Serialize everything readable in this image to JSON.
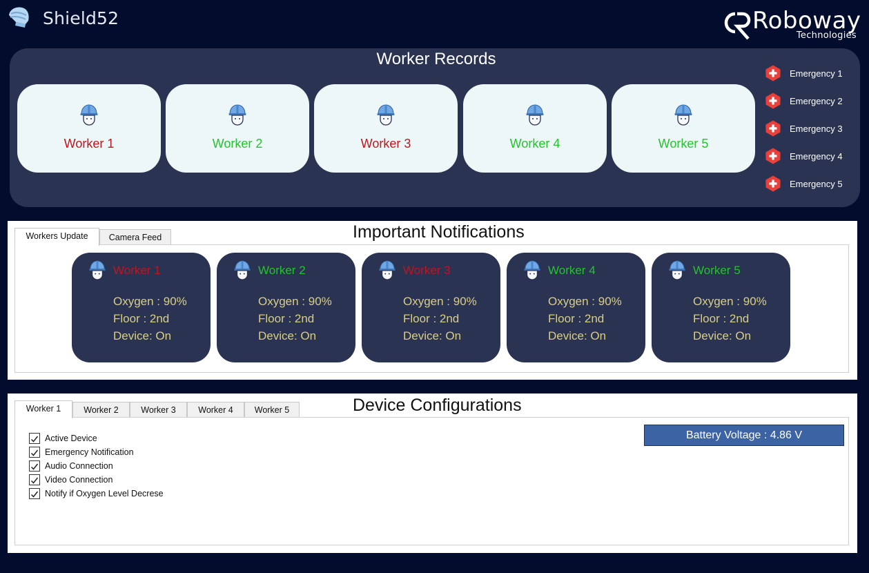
{
  "app": {
    "title": "Shield52"
  },
  "brand": {
    "name": "Roboway",
    "sub": "Technologies"
  },
  "records": {
    "title": "Worker Records",
    "workers": [
      {
        "name": "Worker 1",
        "status_color": "#c0151d"
      },
      {
        "name": "Worker 2",
        "status_color": "#22c42c"
      },
      {
        "name": "Worker 3",
        "status_color": "#c0151d"
      },
      {
        "name": "Worker 4",
        "status_color": "#22c42c"
      },
      {
        "name": "Worker 5",
        "status_color": "#22c42c"
      }
    ],
    "emergencies": [
      "Emergency 1",
      "Emergency 2",
      "Emergency 3",
      "Emergency 4",
      "Emergency 5"
    ]
  },
  "notifications": {
    "title": "Important Notifications",
    "tabs": [
      "Workers Update",
      "Camera Feed"
    ],
    "active_tab": "Workers Update",
    "cards": [
      {
        "name": "Worker 1",
        "status_color": "#c0151d",
        "oxygen": "Oxygen : 90%",
        "floor": "Floor : 2nd",
        "device": "Device: On"
      },
      {
        "name": "Worker 2",
        "status_color": "#22c42c",
        "oxygen": "Oxygen : 90%",
        "floor": "Floor : 2nd",
        "device": "Device: On"
      },
      {
        "name": "Worker 3",
        "status_color": "#c0151d",
        "oxygen": "Oxygen : 90%",
        "floor": "Floor : 2nd",
        "device": "Device: On"
      },
      {
        "name": "Worker 4",
        "status_color": "#22c42c",
        "oxygen": "Oxygen : 90%",
        "floor": "Floor : 2nd",
        "device": "Device: On"
      },
      {
        "name": "Worker 5",
        "status_color": "#22c42c",
        "oxygen": "Oxygen : 90%",
        "floor": "Floor : 2nd",
        "device": "Device: On"
      }
    ]
  },
  "config": {
    "title": "Device Configurations",
    "tabs": [
      "Worker 1",
      "Worker 2",
      "Worker 3",
      "Worker 4",
      "Worker 5"
    ],
    "active_tab": "Worker 1",
    "options": [
      {
        "label": "Active Device",
        "checked": true
      },
      {
        "label": "Emergency Notification",
        "checked": true
      },
      {
        "label": "Audio Connection",
        "checked": true
      },
      {
        "label": "Video Connection",
        "checked": true
      },
      {
        "label": "Notify if Oxygen Level Decrese",
        "checked": true
      }
    ],
    "battery": "Battery Voltage : 4.86 V"
  },
  "icons": {
    "app_logo": "helmet-logo-icon",
    "worker": "worker-helmet-icon",
    "emergency": "medical-cross-icon",
    "checkbox": "checkmark-icon"
  },
  "colors": {
    "background": "#020c2c",
    "panel": "#2a3352",
    "card": "#eef7f8",
    "alert_red": "#c0151d",
    "ok_green": "#22c42c",
    "stat_text": "#d9cf84",
    "emergency": "#e8413b",
    "battery_bg": "#3c63a4"
  }
}
